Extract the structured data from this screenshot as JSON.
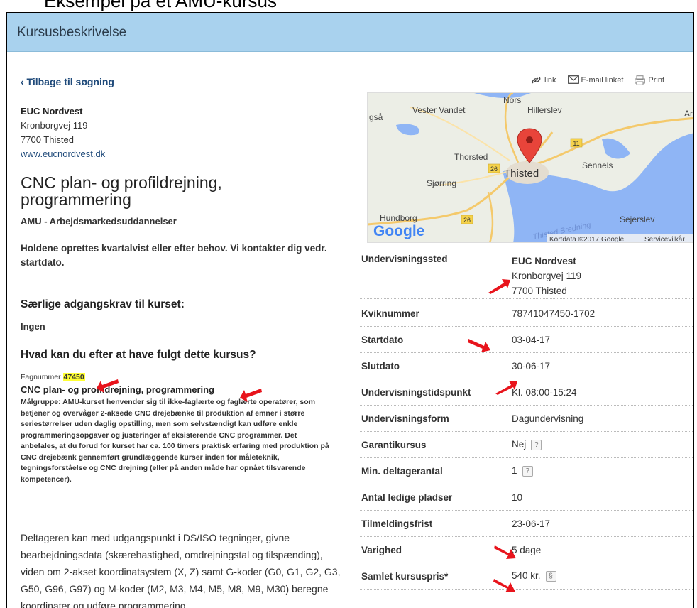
{
  "slide_caption": "Eksempel på et AMU-kursus",
  "header": {
    "title": "Kursusbeskrivelse"
  },
  "back_link": "‹ Tilbage til søgning",
  "provider": {
    "name": "EUC Nordvest",
    "street": "Kronborgvej 119",
    "city": "7700 Thisted",
    "website": "www.eucnordvest.dk"
  },
  "course": {
    "title": "CNC plan- og profildrejning, programmering",
    "type": "AMU - Arbejdsmarkedsuddannelser",
    "intro": "Holdene oprettes kvartalvist eller efter behov. Vi kontakter dig vedr. startdato.",
    "requirements_heading": "Særlige adgangskrav til kurset:",
    "requirements_value": "Ingen",
    "after_heading": "Hvad kan du efter at have fulgt dette kursus?",
    "fagnummer_label": "Fagnummer",
    "fagnummer_value": "47450",
    "fag_title": "CNC plan- og profildrejning, programmering",
    "maalgruppe": "Målgruppe: AMU-kurset henvender sig til ikke-faglærte og faglærte operatører, som betjener og overvåger 2-aksede CNC drejebænke til produktion af emner i større seriestørrelser uden daglig opstilling, men som selvstændigt kan udføre enkle programmeringsopgaver og justeringer af eksisterende CNC programmer. Det anbefales, at du forud for kurset har ca. 100 timers praktisk erfaring med produktion på CNC drejebænk gennemført grundlæggende kurser inden for måleteknik, tegningsforståelse og CNC drejning (eller på anden måde har opnået tilsvarende kompetencer).",
    "deltager": "Deltageren kan med udgangspunkt i DS/ISO tegninger, givne bearbejdningsdata (skærehastighed, omdrejningstal og tilspænding), viden om 2-akset koordinatsystem (X, Z) samt G-koder (G0, G1, G2, G3, G50, G96, G97) og M-koder (M2, M3, M4, M5, M8, M9, M30) beregne koordinater og udføre programmering"
  },
  "tools": {
    "link": "link",
    "email": "E-mail linket",
    "print": "Print"
  },
  "map": {
    "labels": [
      "Nors",
      "Vester Vandet",
      "Hillerslev",
      "Thorsted",
      "Thisted",
      "Sennels",
      "Sjørring",
      "Hundborg",
      "Sejerslev",
      "Thisted Bredning",
      "gså",
      "An"
    ],
    "road_numbers": [
      "11",
      "26",
      "26"
    ],
    "logo": "Google",
    "attribution": "Kortdata ©2017 Google",
    "terms": "Servicevilkår"
  },
  "info": [
    {
      "label": "Undervisningssted",
      "value": "EUC Nordvest",
      "lines": [
        "Kronborgvej 119",
        "7700 Thisted"
      ]
    },
    {
      "label": "Kviknummer",
      "value": "78741047450-1702"
    },
    {
      "label": "Startdato",
      "value": "03-04-17"
    },
    {
      "label": "Slutdato",
      "value": "30-06-17"
    },
    {
      "label": "Undervisningstidspunkt",
      "value": "Kl. 08:00-15:24"
    },
    {
      "label": "Undervisningsform",
      "value": "Dagundervisning"
    },
    {
      "label": "Garantikursus",
      "value": "Nej",
      "icon": "?"
    },
    {
      "label": "Min. deltagerantal",
      "value": "1",
      "icon": "?"
    },
    {
      "label": "Antal ledige pladser",
      "value": "10"
    },
    {
      "label": "Tilmeldingsfrist",
      "value": "23-06-17"
    },
    {
      "label": "Varighed",
      "value": "5 dage"
    },
    {
      "label": "Samlet kursuspris*",
      "value": "540 kr.",
      "icon": "§"
    }
  ],
  "colors": {
    "header_bg": "#a9d2ee",
    "link": "#1f4a7a",
    "highlight": "#ffff33",
    "arrow": "#e8141c",
    "map_water": "#8fb5f5",
    "pin": "#d93a33"
  }
}
